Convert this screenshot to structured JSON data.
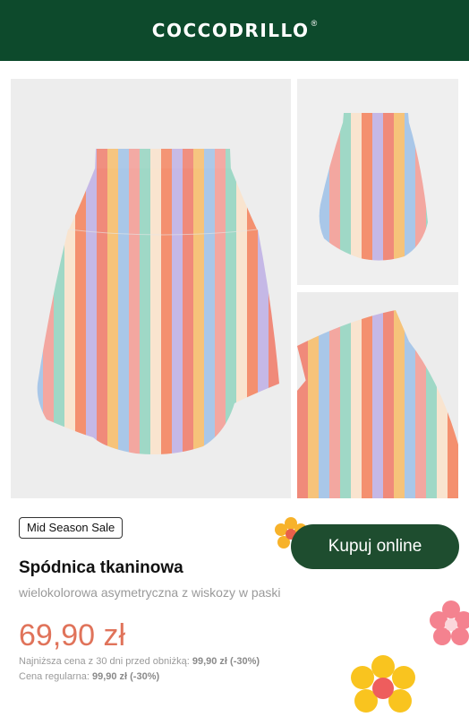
{
  "header": {
    "brand": "COCCODRILLO",
    "registered_mark": "®",
    "background_color": "#0d4a2c"
  },
  "gallery": {
    "images": [
      {
        "name": "skirt-front-view"
      },
      {
        "name": "skirt-small-view"
      },
      {
        "name": "skirt-waistband-closeup"
      }
    ]
  },
  "product": {
    "badge": "Mid Season Sale",
    "title": "Spódnica tkaninowa",
    "subtitle": "wielokolorowa asymetryczna z wiskozy w paski",
    "price": "69,90 zł",
    "price_color": "#e0735a",
    "lowest_price_label": "Najniższa cena z 30 dni przed obniżką:",
    "lowest_price_value": "99,90 zł (-30%)",
    "regular_price_label": "Cena regularna:",
    "regular_price_value": "99,90 zł (-30%)"
  },
  "cta": {
    "label": "Kupuj online",
    "color": "#1e4d2f"
  },
  "decorations": {
    "flowers": [
      "flower-icon-orange",
      "flower-icon-pink",
      "flower-icon-yellow"
    ]
  }
}
